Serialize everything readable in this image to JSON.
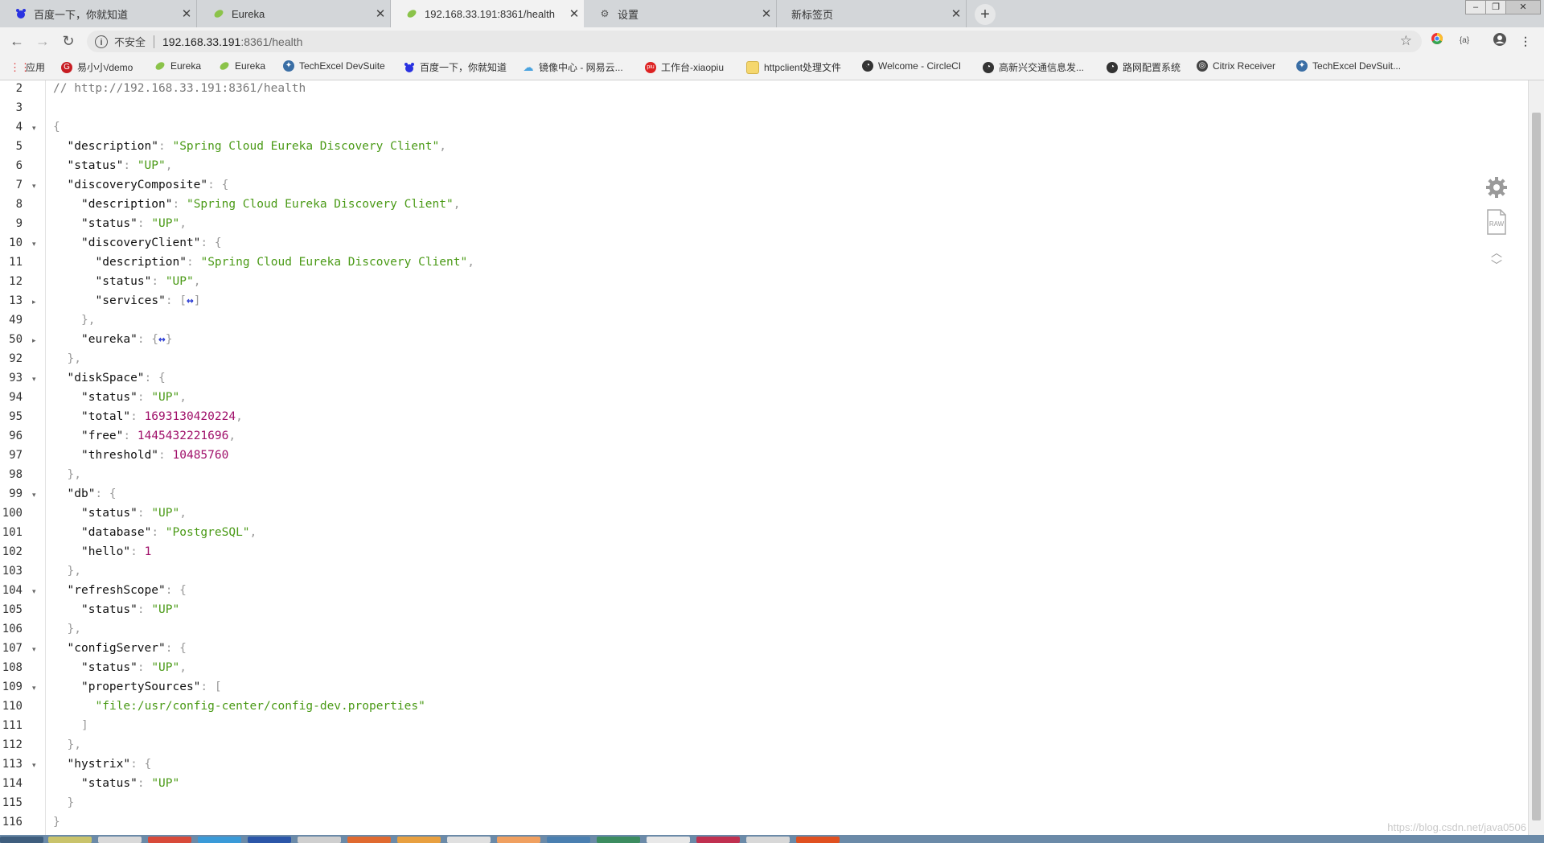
{
  "tabs": [
    {
      "title": "百度一下，你就知道",
      "icon": "baidu-icon",
      "active": false
    },
    {
      "title": "Eureka",
      "icon": "leaf-icon",
      "active": false
    },
    {
      "title": "192.168.33.191:8361/health",
      "icon": "leaf-icon",
      "active": true
    },
    {
      "title": "设置",
      "icon": "gear-icon",
      "active": false
    },
    {
      "title": "新标签页",
      "icon": "",
      "active": false
    }
  ],
  "toolbar": {
    "insecure_label": "不安全",
    "url_host": "192.168.33.191",
    "url_rest": ":8361/health"
  },
  "bookmarks": [
    {
      "label": "应用",
      "icon": "apps-grid-icon",
      "color": "#d33"
    },
    {
      "label": "易小小/demo",
      "icon": "gitee-icon",
      "color": "#c71d23"
    },
    {
      "label": "Eureka",
      "icon": "leaf-icon",
      "color": "#6db33f"
    },
    {
      "label": "Eureka",
      "icon": "leaf-icon",
      "color": "#6db33f"
    },
    {
      "label": "TechExcel DevSuite",
      "icon": "techexcel-icon",
      "color": "#3a6ea5"
    },
    {
      "label": "百度一下，你就知道",
      "icon": "baidu-icon",
      "color": "#2932e1"
    },
    {
      "label": "镜像中心 - 网易云...",
      "icon": "cloud-icon",
      "color": "#4aa3df"
    },
    {
      "label": "工作台-xiaopiu",
      "icon": "xiaopiu-icon",
      "color": "#d22"
    },
    {
      "label": "httpclient处理文件",
      "icon": "folder-icon",
      "color": "#f5c518"
    },
    {
      "label": "Welcome - CircleCI",
      "icon": "globe-icon",
      "color": "#333"
    },
    {
      "label": "高新兴交通信息发...",
      "icon": "globe-icon",
      "color": "#333"
    },
    {
      "label": "路网配置系统",
      "icon": "globe-icon",
      "color": "#333"
    },
    {
      "label": "Citrix Receiver",
      "icon": "citrix-icon",
      "color": "#444"
    },
    {
      "label": "TechExcel DevSuit...",
      "icon": "techexcel-icon",
      "color": "#3a6ea5"
    }
  ],
  "code_lines": [
    {
      "num": "2",
      "fold": "",
      "indent": 0,
      "parts": [
        {
          "t": "c",
          "v": "// http://192.168.33.191:8361/health"
        }
      ]
    },
    {
      "num": "3",
      "fold": "",
      "indent": 0,
      "parts": []
    },
    {
      "num": "4",
      "fold": "▾",
      "indent": 0,
      "parts": [
        {
          "t": "p",
          "v": "{"
        }
      ]
    },
    {
      "num": "5",
      "fold": "",
      "indent": 1,
      "parts": [
        {
          "t": "k",
          "v": "\"description\""
        },
        {
          "t": "p",
          "v": ": "
        },
        {
          "t": "s",
          "v": "\"Spring Cloud Eureka Discovery Client\""
        },
        {
          "t": "p",
          "v": ","
        }
      ]
    },
    {
      "num": "6",
      "fold": "",
      "indent": 1,
      "parts": [
        {
          "t": "k",
          "v": "\"status\""
        },
        {
          "t": "p",
          "v": ": "
        },
        {
          "t": "s",
          "v": "\"UP\""
        },
        {
          "t": "p",
          "v": ","
        }
      ]
    },
    {
      "num": "7",
      "fold": "▾",
      "indent": 1,
      "parts": [
        {
          "t": "k",
          "v": "\"discoveryComposite\""
        },
        {
          "t": "p",
          "v": ": {"
        }
      ]
    },
    {
      "num": "8",
      "fold": "",
      "indent": 2,
      "parts": [
        {
          "t": "k",
          "v": "\"description\""
        },
        {
          "t": "p",
          "v": ": "
        },
        {
          "t": "s",
          "v": "\"Spring Cloud Eureka Discovery Client\""
        },
        {
          "t": "p",
          "v": ","
        }
      ]
    },
    {
      "num": "9",
      "fold": "",
      "indent": 2,
      "parts": [
        {
          "t": "k",
          "v": "\"status\""
        },
        {
          "t": "p",
          "v": ": "
        },
        {
          "t": "s",
          "v": "\"UP\""
        },
        {
          "t": "p",
          "v": ","
        }
      ]
    },
    {
      "num": "10",
      "fold": "▾",
      "indent": 2,
      "parts": [
        {
          "t": "k",
          "v": "\"discoveryClient\""
        },
        {
          "t": "p",
          "v": ": {"
        }
      ]
    },
    {
      "num": "11",
      "fold": "",
      "indent": 3,
      "parts": [
        {
          "t": "k",
          "v": "\"description\""
        },
        {
          "t": "p",
          "v": ": "
        },
        {
          "t": "s",
          "v": "\"Spring Cloud Eureka Discovery Client\""
        },
        {
          "t": "p",
          "v": ","
        }
      ]
    },
    {
      "num": "12",
      "fold": "",
      "indent": 3,
      "parts": [
        {
          "t": "k",
          "v": "\"status\""
        },
        {
          "t": "p",
          "v": ": "
        },
        {
          "t": "s",
          "v": "\"UP\""
        },
        {
          "t": "p",
          "v": ","
        }
      ]
    },
    {
      "num": "13",
      "fold": "▸",
      "indent": 3,
      "parts": [
        {
          "t": "k",
          "v": "\"services\""
        },
        {
          "t": "p",
          "v": ": ["
        },
        {
          "t": "ell",
          "v": "↔"
        },
        {
          "t": "p",
          "v": "]"
        }
      ]
    },
    {
      "num": "49",
      "fold": "",
      "indent": 2,
      "parts": [
        {
          "t": "p",
          "v": "},"
        }
      ]
    },
    {
      "num": "50",
      "fold": "▸",
      "indent": 2,
      "parts": [
        {
          "t": "k",
          "v": "\"eureka\""
        },
        {
          "t": "p",
          "v": ": {"
        },
        {
          "t": "ell",
          "v": "↔"
        },
        {
          "t": "p",
          "v": "}"
        }
      ]
    },
    {
      "num": "92",
      "fold": "",
      "indent": 1,
      "parts": [
        {
          "t": "p",
          "v": "},"
        }
      ]
    },
    {
      "num": "93",
      "fold": "▾",
      "indent": 1,
      "parts": [
        {
          "t": "k",
          "v": "\"diskSpace\""
        },
        {
          "t": "p",
          "v": ": {"
        }
      ]
    },
    {
      "num": "94",
      "fold": "",
      "indent": 2,
      "parts": [
        {
          "t": "k",
          "v": "\"status\""
        },
        {
          "t": "p",
          "v": ": "
        },
        {
          "t": "s",
          "v": "\"UP\""
        },
        {
          "t": "p",
          "v": ","
        }
      ]
    },
    {
      "num": "95",
      "fold": "",
      "indent": 2,
      "parts": [
        {
          "t": "k",
          "v": "\"total\""
        },
        {
          "t": "p",
          "v": ": "
        },
        {
          "t": "n",
          "v": "1693130420224"
        },
        {
          "t": "p",
          "v": ","
        }
      ]
    },
    {
      "num": "96",
      "fold": "",
      "indent": 2,
      "parts": [
        {
          "t": "k",
          "v": "\"free\""
        },
        {
          "t": "p",
          "v": ": "
        },
        {
          "t": "n",
          "v": "1445432221696"
        },
        {
          "t": "p",
          "v": ","
        }
      ]
    },
    {
      "num": "97",
      "fold": "",
      "indent": 2,
      "parts": [
        {
          "t": "k",
          "v": "\"threshold\""
        },
        {
          "t": "p",
          "v": ": "
        },
        {
          "t": "n",
          "v": "10485760"
        }
      ]
    },
    {
      "num": "98",
      "fold": "",
      "indent": 1,
      "parts": [
        {
          "t": "p",
          "v": "},"
        }
      ]
    },
    {
      "num": "99",
      "fold": "▾",
      "indent": 1,
      "parts": [
        {
          "t": "k",
          "v": "\"db\""
        },
        {
          "t": "p",
          "v": ": {"
        }
      ]
    },
    {
      "num": "100",
      "fold": "",
      "indent": 2,
      "parts": [
        {
          "t": "k",
          "v": "\"status\""
        },
        {
          "t": "p",
          "v": ": "
        },
        {
          "t": "s",
          "v": "\"UP\""
        },
        {
          "t": "p",
          "v": ","
        }
      ]
    },
    {
      "num": "101",
      "fold": "",
      "indent": 2,
      "parts": [
        {
          "t": "k",
          "v": "\"database\""
        },
        {
          "t": "p",
          "v": ": "
        },
        {
          "t": "s",
          "v": "\"PostgreSQL\""
        },
        {
          "t": "p",
          "v": ","
        }
      ]
    },
    {
      "num": "102",
      "fold": "",
      "indent": 2,
      "parts": [
        {
          "t": "k",
          "v": "\"hello\""
        },
        {
          "t": "p",
          "v": ": "
        },
        {
          "t": "n",
          "v": "1"
        }
      ]
    },
    {
      "num": "103",
      "fold": "",
      "indent": 1,
      "parts": [
        {
          "t": "p",
          "v": "},"
        }
      ]
    },
    {
      "num": "104",
      "fold": "▾",
      "indent": 1,
      "parts": [
        {
          "t": "k",
          "v": "\"refreshScope\""
        },
        {
          "t": "p",
          "v": ": {"
        }
      ]
    },
    {
      "num": "105",
      "fold": "",
      "indent": 2,
      "parts": [
        {
          "t": "k",
          "v": "\"status\""
        },
        {
          "t": "p",
          "v": ": "
        },
        {
          "t": "s",
          "v": "\"UP\""
        }
      ]
    },
    {
      "num": "106",
      "fold": "",
      "indent": 1,
      "parts": [
        {
          "t": "p",
          "v": "},"
        }
      ]
    },
    {
      "num": "107",
      "fold": "▾",
      "indent": 1,
      "parts": [
        {
          "t": "k",
          "v": "\"configServer\""
        },
        {
          "t": "p",
          "v": ": {"
        }
      ]
    },
    {
      "num": "108",
      "fold": "",
      "indent": 2,
      "parts": [
        {
          "t": "k",
          "v": "\"status\""
        },
        {
          "t": "p",
          "v": ": "
        },
        {
          "t": "s",
          "v": "\"UP\""
        },
        {
          "t": "p",
          "v": ","
        }
      ]
    },
    {
      "num": "109",
      "fold": "▾",
      "indent": 2,
      "parts": [
        {
          "t": "k",
          "v": "\"propertySources\""
        },
        {
          "t": "p",
          "v": ": ["
        }
      ]
    },
    {
      "num": "110",
      "fold": "",
      "indent": 3,
      "parts": [
        {
          "t": "s",
          "v": "\"file:/usr/config-center/config-dev.properties\""
        }
      ]
    },
    {
      "num": "111",
      "fold": "",
      "indent": 2,
      "parts": [
        {
          "t": "p",
          "v": "]"
        }
      ]
    },
    {
      "num": "112",
      "fold": "",
      "indent": 1,
      "parts": [
        {
          "t": "p",
          "v": "},"
        }
      ]
    },
    {
      "num": "113",
      "fold": "▾",
      "indent": 1,
      "parts": [
        {
          "t": "k",
          "v": "\"hystrix\""
        },
        {
          "t": "p",
          "v": ": {"
        }
      ]
    },
    {
      "num": "114",
      "fold": "",
      "indent": 2,
      "parts": [
        {
          "t": "k",
          "v": "\"status\""
        },
        {
          "t": "p",
          "v": ": "
        },
        {
          "t": "s",
          "v": "\"UP\""
        }
      ]
    },
    {
      "num": "115",
      "fold": "",
      "indent": 1,
      "parts": [
        {
          "t": "p",
          "v": "}"
        }
      ]
    },
    {
      "num": "116",
      "fold": "",
      "indent": 0,
      "parts": [
        {
          "t": "p",
          "v": "}"
        }
      ]
    }
  ],
  "right_tools": {
    "raw_label": "RAW"
  },
  "watermark": "https://blog.csdn.net/java0506"
}
